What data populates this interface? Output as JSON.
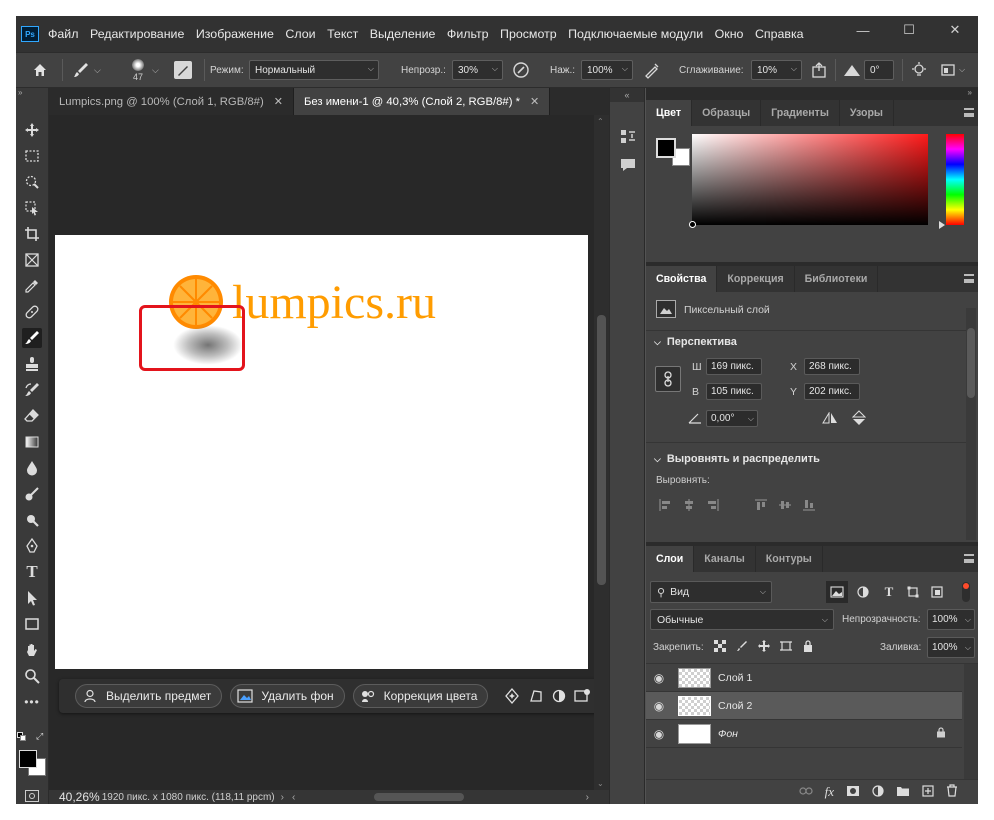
{
  "app": {
    "logo": "Ps"
  },
  "menu": [
    "Файл",
    "Редактирование",
    "Изображение",
    "Слои",
    "Текст",
    "Выделение",
    "Фильтр",
    "Просмотр",
    "Подключаемые модули",
    "Окно",
    "Справка"
  ],
  "window_controls": {
    "minimize": "—",
    "maximize": "☐",
    "close": "✕"
  },
  "options": {
    "brush_size": "47",
    "mode_label": "Режим:",
    "mode_value": "Нормальный",
    "opacity_label": "Непрозр.:",
    "opacity_value": "30%",
    "flow_label": "Наж.:",
    "flow_value": "100%",
    "smoothing_label": "Сглаживание:",
    "smoothing_value": "10%",
    "angle_value": "0°"
  },
  "tabs": [
    {
      "label": "Lumpics.png @ 100% (Слой 1, RGB/8#)",
      "close": "✕"
    },
    {
      "label": "Без имени-1 @ 40,3% (Слой 2, RGB/8#) *",
      "close": "✕"
    }
  ],
  "canvas": {
    "logo_text": "lumpics.ru",
    "accent": "#ff9c00",
    "highlight_color": "#e3141c"
  },
  "taskbar": {
    "select_subject": "Выделить предмет",
    "remove_bg": "Удалить фон",
    "color_correction": "Коррекция цвета",
    "more": "•••"
  },
  "status": {
    "zoom": "40,26%",
    "info": "1920 пикс. x 1080 пикс. (118,11 ppcm)"
  },
  "color_panel": {
    "tabs": [
      "Цвет",
      "Образцы",
      "Градиенты",
      "Узоры"
    ],
    "gradient_hue": "#ff1a1a"
  },
  "properties_panel": {
    "tabs": [
      "Свойства",
      "Коррекция",
      "Библиотеки"
    ],
    "layer_type": "Пиксельный слой",
    "perspective_title": "Перспектива",
    "w_label": "Ш",
    "w_value": "169 пикс.",
    "h_label": "В",
    "h_value": "105 пикс.",
    "x_label": "X",
    "x_value": "268 пикс.",
    "y_label": "Y",
    "y_value": "202 пикс.",
    "angle_value": "0,00°",
    "align_title": "Выровнять и распределить",
    "align_label": "Выровнять:"
  },
  "layers_panel": {
    "tabs": [
      "Слои",
      "Каналы",
      "Контуры"
    ],
    "filter_label": "Вид",
    "blend_mode": "Обычные",
    "opacity_label": "Непрозрачность:",
    "opacity_value": "100%",
    "lock_label": "Закрепить:",
    "fill_label": "Заливка:",
    "fill_value": "100%",
    "layers": [
      {
        "name": "Слой 1",
        "selected": false
      },
      {
        "name": "Слой 2",
        "selected": true
      },
      {
        "name": "Фон",
        "selected": false
      }
    ]
  }
}
